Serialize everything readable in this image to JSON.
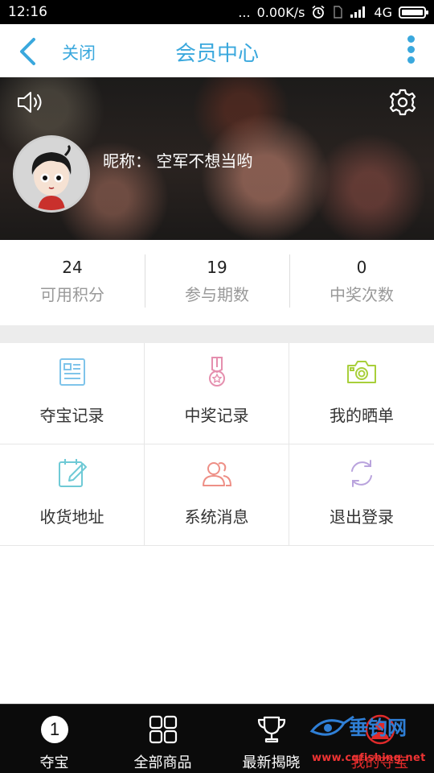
{
  "status_bar": {
    "time": "12:16",
    "dots": "...",
    "speed": "0.00K/s",
    "network": "4G"
  },
  "header": {
    "close_label": "关闭",
    "title": "会员中心"
  },
  "profile": {
    "nickname_text": "昵称： 空军不想当哟"
  },
  "stats": [
    {
      "value": "24",
      "label": "可用积分"
    },
    {
      "value": "19",
      "label": "参与期数"
    },
    {
      "value": "0",
      "label": "中奖次数"
    }
  ],
  "menu": [
    {
      "label": "夺宝记录",
      "icon": "document-icon",
      "color": "#7fc4ea"
    },
    {
      "label": "中奖记录",
      "icon": "medal-icon",
      "color": "#e58fae"
    },
    {
      "label": "我的晒单",
      "icon": "camera-icon",
      "color": "#a8cf3a"
    },
    {
      "label": "收货地址",
      "icon": "edit-note-icon",
      "color": "#6fcad6"
    },
    {
      "label": "系统消息",
      "icon": "users-icon",
      "color": "#ee8f86"
    },
    {
      "label": "退出登录",
      "icon": "refresh-icon",
      "color": "#b9a3dd"
    }
  ],
  "bottom_nav": [
    {
      "label": "夺宝",
      "badge": "1"
    },
    {
      "label": "全部商品"
    },
    {
      "label": "最新揭晓"
    },
    {
      "label": "我的夺宝"
    }
  ],
  "watermark": {
    "brand": "垂钓网",
    "url": "www.cqfishing.net"
  },
  "colors": {
    "accent": "#3aa8dd",
    "nav_bg": "#0b0b0b",
    "active_red": "#e02a2a"
  }
}
